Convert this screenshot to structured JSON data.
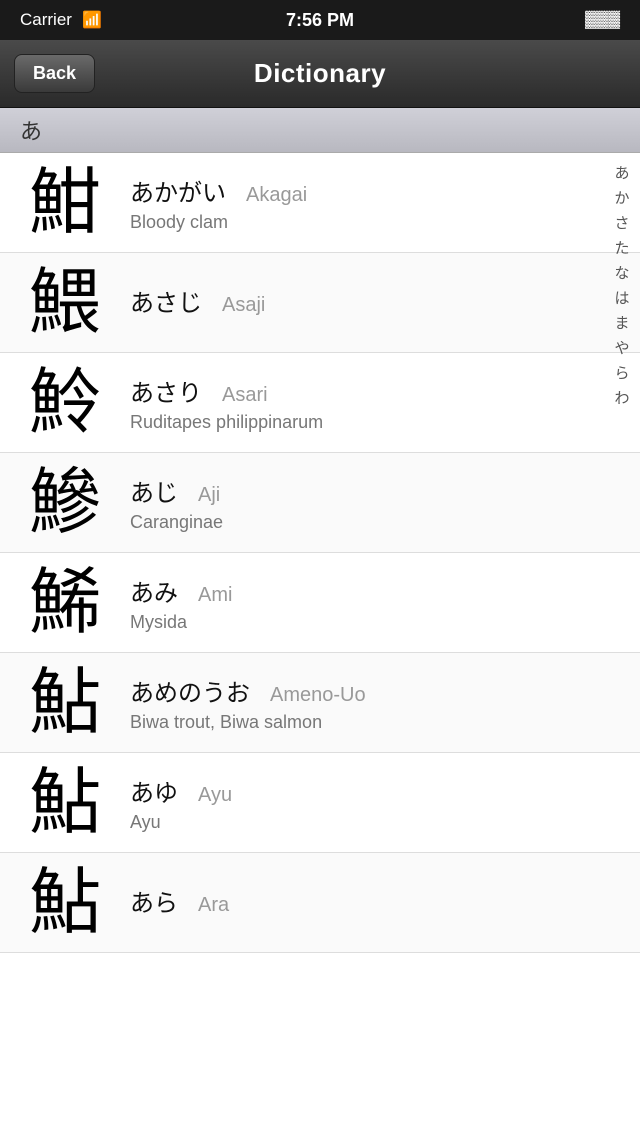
{
  "status": {
    "carrier": "Carrier",
    "time": "7:56 PM",
    "wifi": "📶",
    "battery": "🔋"
  },
  "nav": {
    "back_label": "Back",
    "title": "Dictionary"
  },
  "section": {
    "header": "あ"
  },
  "index": {
    "items": [
      "あ",
      "か",
      "さ",
      "た",
      "な",
      "は",
      "ま",
      "や",
      "ら",
      "わ"
    ]
  },
  "entries": [
    {
      "kanji": "魽",
      "hiragana": "あかがい",
      "romanji": "Akagai",
      "english": "Bloody clam"
    },
    {
      "kanji": "鰃",
      "hiragana": "あさじ",
      "romanji": "Asaji",
      "english": ""
    },
    {
      "kanji": "魿",
      "hiragana": "あさり",
      "romanji": "Asari",
      "english": "Ruditapes philippinarum"
    },
    {
      "kanji": "鰺",
      "hiragana": "あじ",
      "romanji": "Aji",
      "english": "Caranginae"
    },
    {
      "kanji": "鯑",
      "hiragana": "あみ",
      "romanji": "Ami",
      "english": "Mysida"
    },
    {
      "kanji": "鮎",
      "hiragana": "あめのうお",
      "romanji": "Ameno-Uo",
      "english": "Biwa trout, Biwa salmon"
    },
    {
      "kanji": "鮎",
      "hiragana": "あゆ",
      "romanji": "Ayu",
      "english": "Ayu"
    },
    {
      "kanji": "鮎",
      "hiragana": "あら",
      "romanji": "Ara",
      "english": ""
    }
  ]
}
